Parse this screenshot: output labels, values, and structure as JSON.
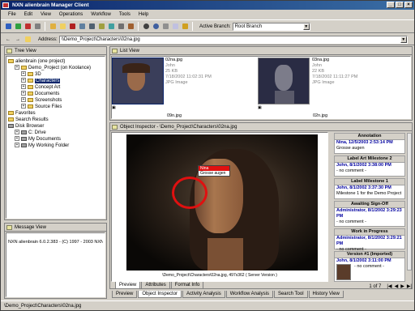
{
  "window": {
    "title": "NXN alienbrain Manager Client"
  },
  "menu": [
    "File",
    "Edit",
    "View",
    "Operations",
    "Workflow",
    "Tools",
    "Help"
  ],
  "toolbar": {
    "branch_label": "Active Branch:",
    "branch_value": "Root Branch"
  },
  "address": {
    "label": "Address:",
    "value": "\\\\Demo_Project\\Characters\\02na.jpg"
  },
  "tree": {
    "title": "Tree View",
    "items": [
      {
        "label": "alienbrain (one project)",
        "level": 0,
        "type": "root"
      },
      {
        "label": "Demo_Project (on Koolance)",
        "level": 1,
        "type": "project"
      },
      {
        "label": "3D",
        "level": 2,
        "type": "folder"
      },
      {
        "label": "Characters",
        "level": 2,
        "type": "folder",
        "selected": true
      },
      {
        "label": "Concept Art",
        "level": 2,
        "type": "folder"
      },
      {
        "label": "Documents",
        "level": 2,
        "type": "folder"
      },
      {
        "label": "Screenshots",
        "level": 2,
        "type": "folder"
      },
      {
        "label": "Source Files",
        "level": 2,
        "type": "folder"
      },
      {
        "label": "Favorites",
        "level": 0,
        "type": "fav"
      },
      {
        "label": "Search Results",
        "level": 0,
        "type": "search"
      },
      {
        "label": "Disk Browser",
        "level": 0,
        "type": "disk"
      },
      {
        "label": "C: Drive",
        "level": 1,
        "type": "drive"
      },
      {
        "label": "My Documents",
        "level": 1,
        "type": "drive"
      },
      {
        "label": "My Working Folder",
        "level": 1,
        "type": "drive"
      }
    ]
  },
  "message": {
    "title": "Message View",
    "text": "NXN alienbrain 6.0.2.383 - (C) 1997 - 2003 NXN S"
  },
  "list": {
    "title": "List View",
    "items": [
      {
        "name": "02na.jpg",
        "owner": "John",
        "size": "25 KB",
        "date": "7/18/2002 11:02:31 PM",
        "type": "JPG Image",
        "caption": "09n.jpg"
      },
      {
        "name": "03na.jpg",
        "owner": "John",
        "size": "22 KB",
        "date": "7/18/2002 11:11:27 PM",
        "type": "JPG Image",
        "caption": "02n.jpg"
      }
    ]
  },
  "inspector": {
    "title": "Object Inspector - \\Demo_Project\\Characters\\02na.jpg",
    "tooltip_name": "Nina",
    "tooltip_text": "Grosse augen",
    "caption": "\\Demo_Project\\Characters\\02na.jpg, 497x362 ( Server Version )",
    "tabs": [
      "Preview",
      "Attributes",
      "Format Info"
    ]
  },
  "annotations": [
    {
      "head": "Annotation",
      "author": "Nina, 12/5/2003 2:53:14 PM",
      "text": "Grosse augen"
    },
    {
      "head": "Label Art Milestone 2",
      "author": "John, 8/1/2002 3:38:00 PM",
      "text": "- no comment -"
    },
    {
      "head": "Label Milestone 1",
      "author": "John, 8/1/2002 3:37:30 PM",
      "text": "Milestone 1 for the Demo Project"
    },
    {
      "head": "Awaiting Sign-Off",
      "author": "Administrator, 8/1/2002 3:29:23 PM",
      "text": "- no comment -"
    },
    {
      "head": "Work in Progress",
      "author": "Administrator, 8/1/2002 3:29:21 PM",
      "text": "- no comment -"
    },
    {
      "head": "Version #1 (Imported)",
      "author": "John, 8/1/2002 3:11:00 PM",
      "text": "- no comment -"
    }
  ],
  "pager": {
    "text": "1 of 7"
  },
  "bottom_tabs": [
    "Preview",
    "Object Inspector",
    "Activity Analysis",
    "Workflow Analysis",
    "Search Tool",
    "History View"
  ],
  "status": {
    "text": "\\Demo_Project\\Characters\\02na.jpg"
  }
}
